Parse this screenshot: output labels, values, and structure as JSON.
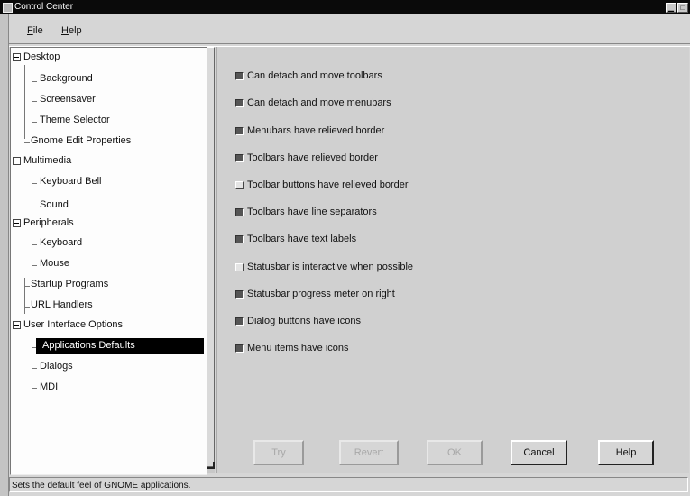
{
  "window": {
    "title": "Control Center"
  },
  "menubar": {
    "file": {
      "mnemonic": "F",
      "rest": "ile"
    },
    "help": {
      "mnemonic": "H",
      "rest": "elp"
    }
  },
  "tree": {
    "items": [
      {
        "label": "Desktop"
      },
      {
        "label": "Background"
      },
      {
        "label": "Screensaver"
      },
      {
        "label": "Theme Selector"
      },
      {
        "label": "Gnome Edit Properties"
      },
      {
        "label": "Multimedia"
      },
      {
        "label": "Keyboard Bell"
      },
      {
        "label": "Sound"
      },
      {
        "label": "Peripherals"
      },
      {
        "label": "Keyboard"
      },
      {
        "label": "Mouse"
      },
      {
        "label": "Startup Programs"
      },
      {
        "label": "URL Handlers"
      },
      {
        "label": "User Interface Options"
      },
      {
        "label": "Applications Defaults",
        "selected": true
      },
      {
        "label": "Dialogs"
      },
      {
        "label": "MDI"
      }
    ]
  },
  "options": [
    {
      "label": "Can detach and move toolbars",
      "checked": true
    },
    {
      "label": "Can detach and move menubars",
      "checked": true
    },
    {
      "label": "Menubars have relieved border",
      "checked": true
    },
    {
      "label": "Toolbars have relieved border",
      "checked": true
    },
    {
      "label": "Toolbar buttons have relieved border",
      "checked": false
    },
    {
      "label": "Toolbars have line separators",
      "checked": true
    },
    {
      "label": "Toolbars have text labels",
      "checked": true
    },
    {
      "label": "Statusbar is interactive when possible",
      "checked": false
    },
    {
      "label": "Statusbar progress meter on right",
      "checked": true
    },
    {
      "label": "Dialog buttons have icons",
      "checked": true
    },
    {
      "label": "Menu items have icons",
      "checked": true
    }
  ],
  "buttons": {
    "try": "Try",
    "revert": "Revert",
    "ok": "OK",
    "cancel": "Cancel",
    "help": "Help"
  },
  "status": {
    "text": "Sets the default feel of GNOME applications."
  }
}
